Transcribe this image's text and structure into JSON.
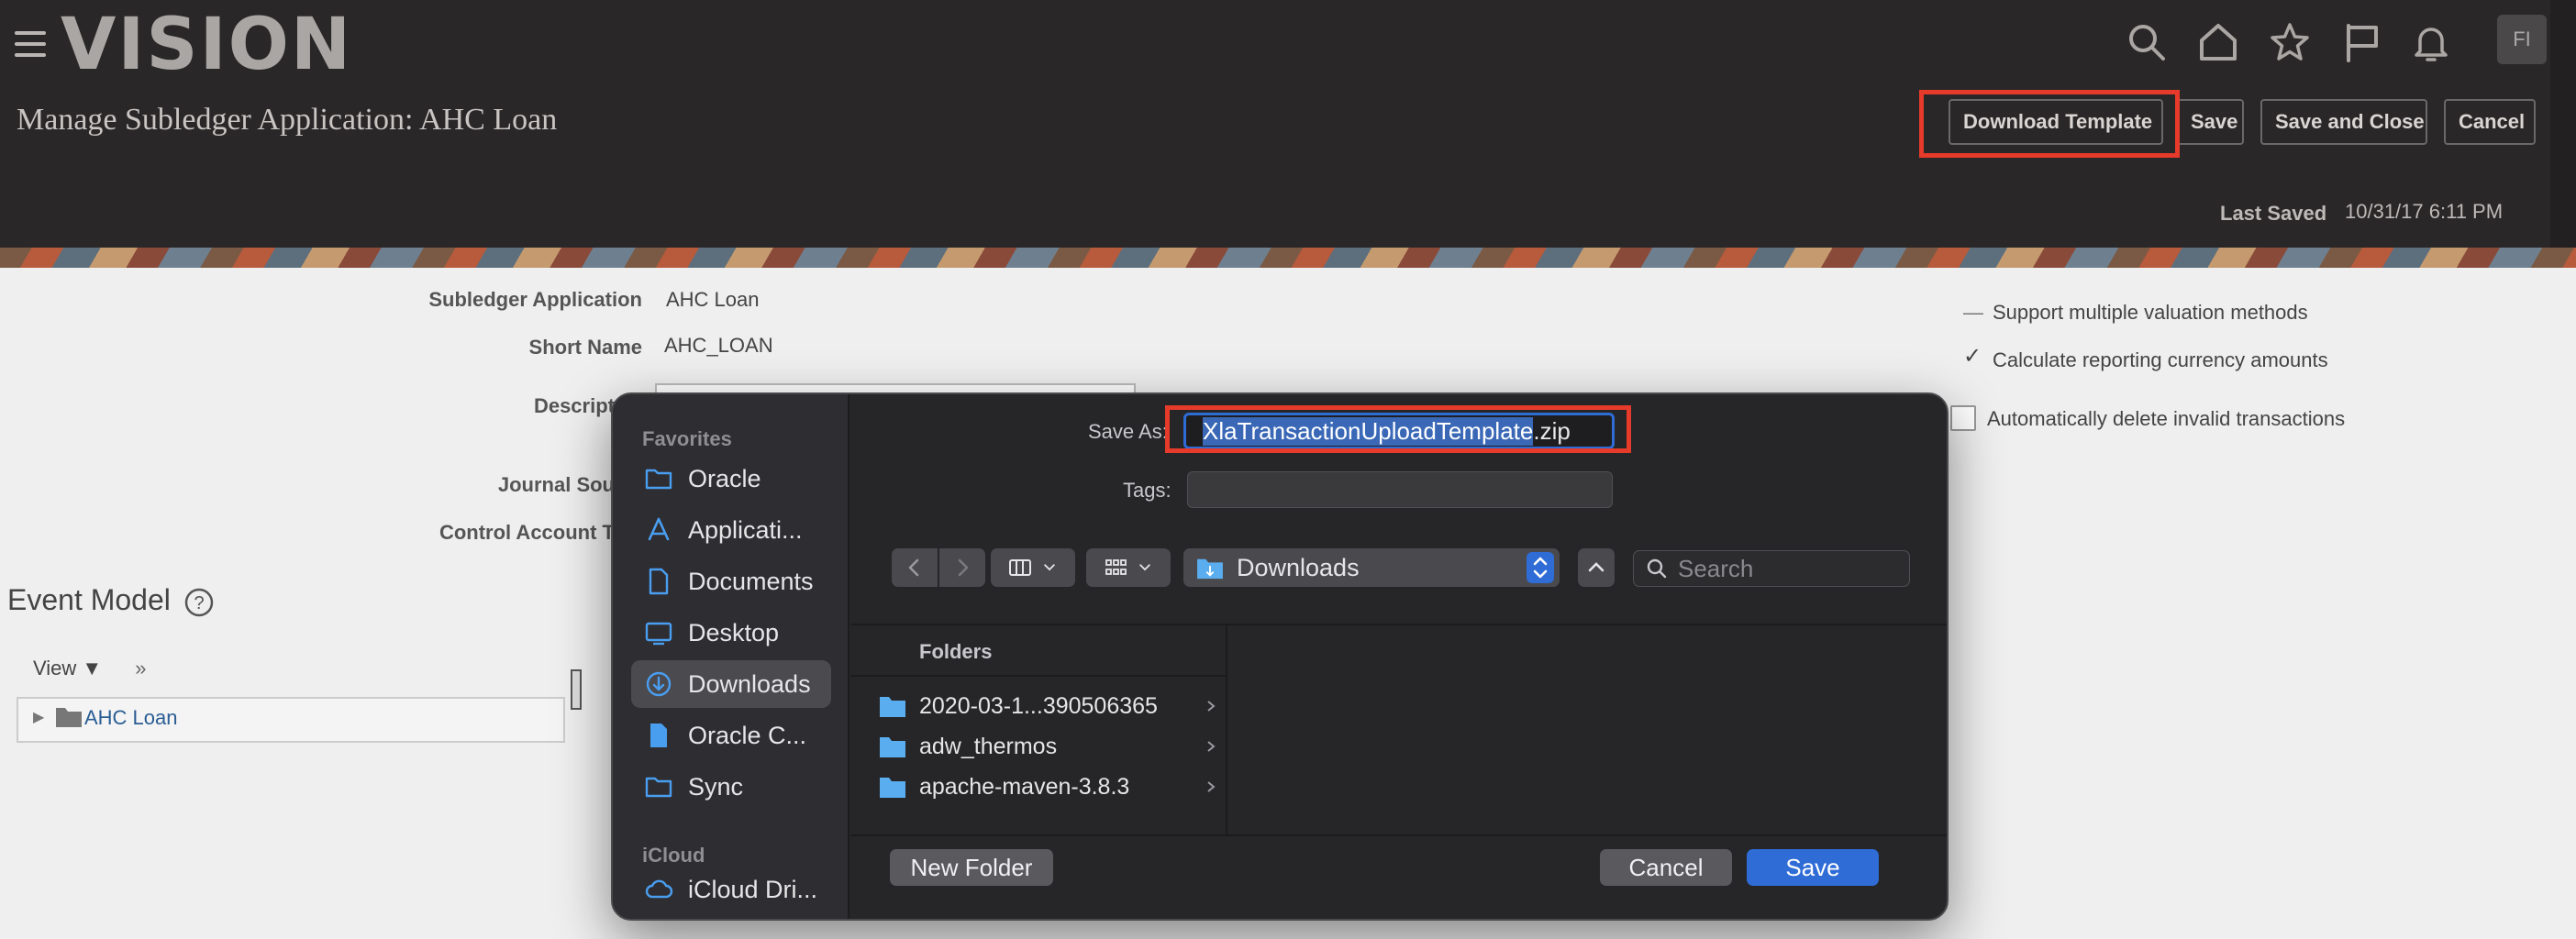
{
  "app": {
    "logo": "VISION",
    "avatar_initials": "FI",
    "page_title": "Manage Subledger Application: AHC Loan"
  },
  "header_buttons": {
    "download_template": "Download Template",
    "save": "Save",
    "save_and_close": "Save and Close",
    "cancel": "Cancel"
  },
  "last_saved": {
    "label": "Last Saved",
    "value": "10/31/17 6:11 PM"
  },
  "form": {
    "subledger_application_label": "Subledger Application",
    "subledger_application_value": "AHC Loan",
    "short_name_label": "Short Name",
    "short_name_value": "AHC_LOAN",
    "description_label": "Descript",
    "journal_source_label": "Journal Sou",
    "control_account_label": "Control Account T"
  },
  "options": {
    "support_multiple_valuation": "Support multiple valuation methods",
    "calculate_reporting_currency": "Calculate reporting currency amounts",
    "auto_delete_invalid": "Automatically delete invalid transactions"
  },
  "event_model": {
    "title": "Event Model",
    "view_menu": "View",
    "tree_root": "AHC Loan"
  },
  "dialog": {
    "save_as_label": "Save As:",
    "save_as_name": "XlaTransactionUploadTemplate",
    "save_as_ext": ".zip",
    "tags_label": "Tags:",
    "location": "Downloads",
    "search_placeholder": "Search",
    "sidebar": {
      "favorites_header": "Favorites",
      "icloud_header": "iCloud",
      "items": [
        {
          "label": "Oracle",
          "icon": "folder-icon"
        },
        {
          "label": "Applicati...",
          "icon": "applications-icon"
        },
        {
          "label": "Documents",
          "icon": "document-icon"
        },
        {
          "label": "Desktop",
          "icon": "desktop-icon"
        },
        {
          "label": "Downloads",
          "icon": "download-icon"
        },
        {
          "label": "Oracle C...",
          "icon": "file-icon"
        },
        {
          "label": "Sync",
          "icon": "folder-icon"
        }
      ],
      "icloud_items": [
        {
          "label": "iCloud Dri...",
          "icon": "cloud-icon"
        }
      ]
    },
    "folders_header": "Folders",
    "folders": [
      "2020-03-1...390506365",
      "adw_thermos",
      "apache-maven-3.8.3"
    ],
    "new_folder": "New Folder",
    "cancel": "Cancel",
    "save": "Save"
  },
  "colors": {
    "header_bg": "#2a2728",
    "highlight_red": "#e63a2a",
    "dialog_bg": "#262628",
    "accent_blue": "#2f6cd6",
    "folder_blue": "#5aaef0"
  }
}
